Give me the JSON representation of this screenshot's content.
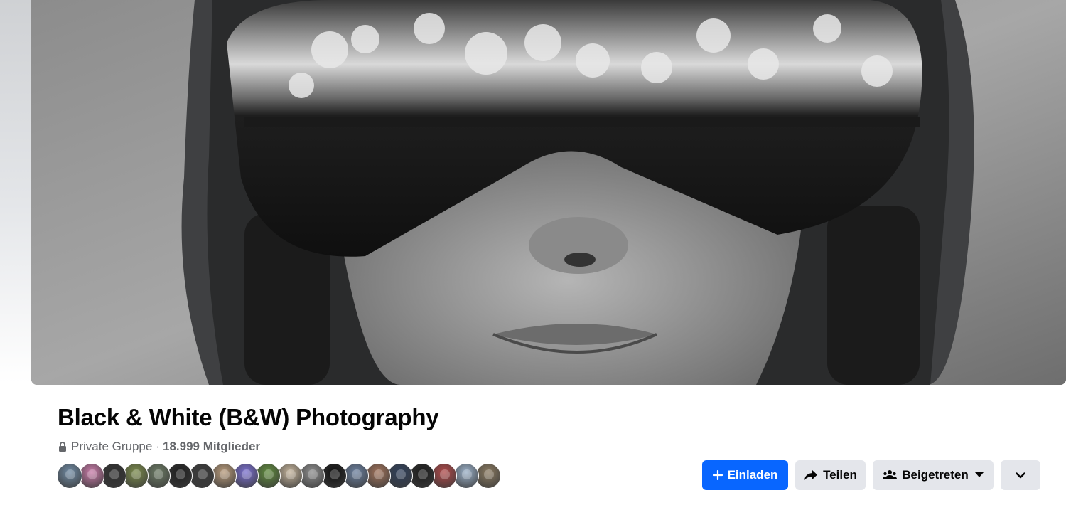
{
  "group": {
    "name": "Black & White (B&W) Photography",
    "privacy": "Private Gruppe",
    "separator": "·",
    "member_count": "18.999 Mitglieder"
  },
  "cover": {
    "description_icon": "cover-photo",
    "palette": [
      "#2b2b2b",
      "#7a7a7a",
      "#cfcfcf"
    ]
  },
  "members": {
    "avatar_colors": [
      "#6f8aa3",
      "#c97aa8",
      "#2e2e2e",
      "#7a8a4a",
      "#6b7a63",
      "#1f1f1f",
      "#3a3a3a",
      "#b89a7a",
      "#7a6fd0",
      "#5f8a3c",
      "#c4b39a",
      "#8c8c8c",
      "#101010",
      "#6a7f9e",
      "#a0725a",
      "#2f3f5a",
      "#1c1c1c",
      "#b04848",
      "#9ab0c8",
      "#8a7a60"
    ]
  },
  "actions": {
    "invite_label": "Einladen",
    "share_label": "Teilen",
    "joined_label": "Beigetreten",
    "accent": "#0866ff",
    "secondary_bg": "#e4e6eb"
  },
  "icons": {
    "lock": "lock-icon",
    "plus": "plus-icon",
    "share": "share-arrow-icon",
    "group": "group-members-icon",
    "caret": "caret-down-icon",
    "chevron": "chevron-down-icon"
  }
}
